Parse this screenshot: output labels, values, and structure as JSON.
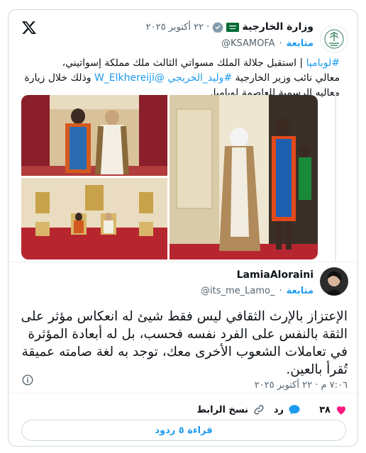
{
  "header": {
    "org_name": "وزارة الخارجية",
    "date": "٢٢ أكتوبر ٢٠٢٥",
    "separator": "·",
    "handle": "@KSAMOFA",
    "follow_label": "متابعة"
  },
  "tweet": {
    "line1_hashtag": "#لوباميا",
    "line1_text": " | استقبل جلالة الملك مسواتي الثالث ملك مملكة إسواتيني،",
    "line2_text": "معالي نائب وزير الخارجية ",
    "line2_hashtag": "#وليد_الخريجي",
    "line2_mention": " @W_Elkhereiji",
    "line2_tail": " وذلك خلال زيارة",
    "line3_text": "معاليه الرسمية للعاصمة لوبامبا."
  },
  "reply": {
    "user_name": "LamiaAloraini",
    "handle": "@its_me_Lamo_",
    "follow_label": "متابعة",
    "text": "الإعتزاز بالإرث الثقافي ليس فقط شيئ له انعكاس مؤثر على الثقة بالنفس على الفرد نفسه فحسب، بل له أبعادة المؤثرة في تعاملات الشعوب الأخرى معك، توجد به لغة صامته عميقة تُقرأ بالعين.",
    "time": "٧:٠٦ م · ٢٢ أكتوبر ٢٠٢٥"
  },
  "actions": {
    "likes_count": "٣٨",
    "reply_label": "رد",
    "copy_link_label": "نسخ الرابط",
    "read_replies_label": "قراءة ٥ ردود"
  },
  "colors": {
    "accent": "#1d9bf0",
    "like": "#f91880",
    "muted": "#536471",
    "border": "#cfd9de"
  },
  "icons": [
    "x-logo-icon",
    "saudi-flag-icon",
    "verified-badge-icon",
    "info-icon",
    "heart-icon",
    "reply-bubble-icon",
    "link-icon"
  ]
}
